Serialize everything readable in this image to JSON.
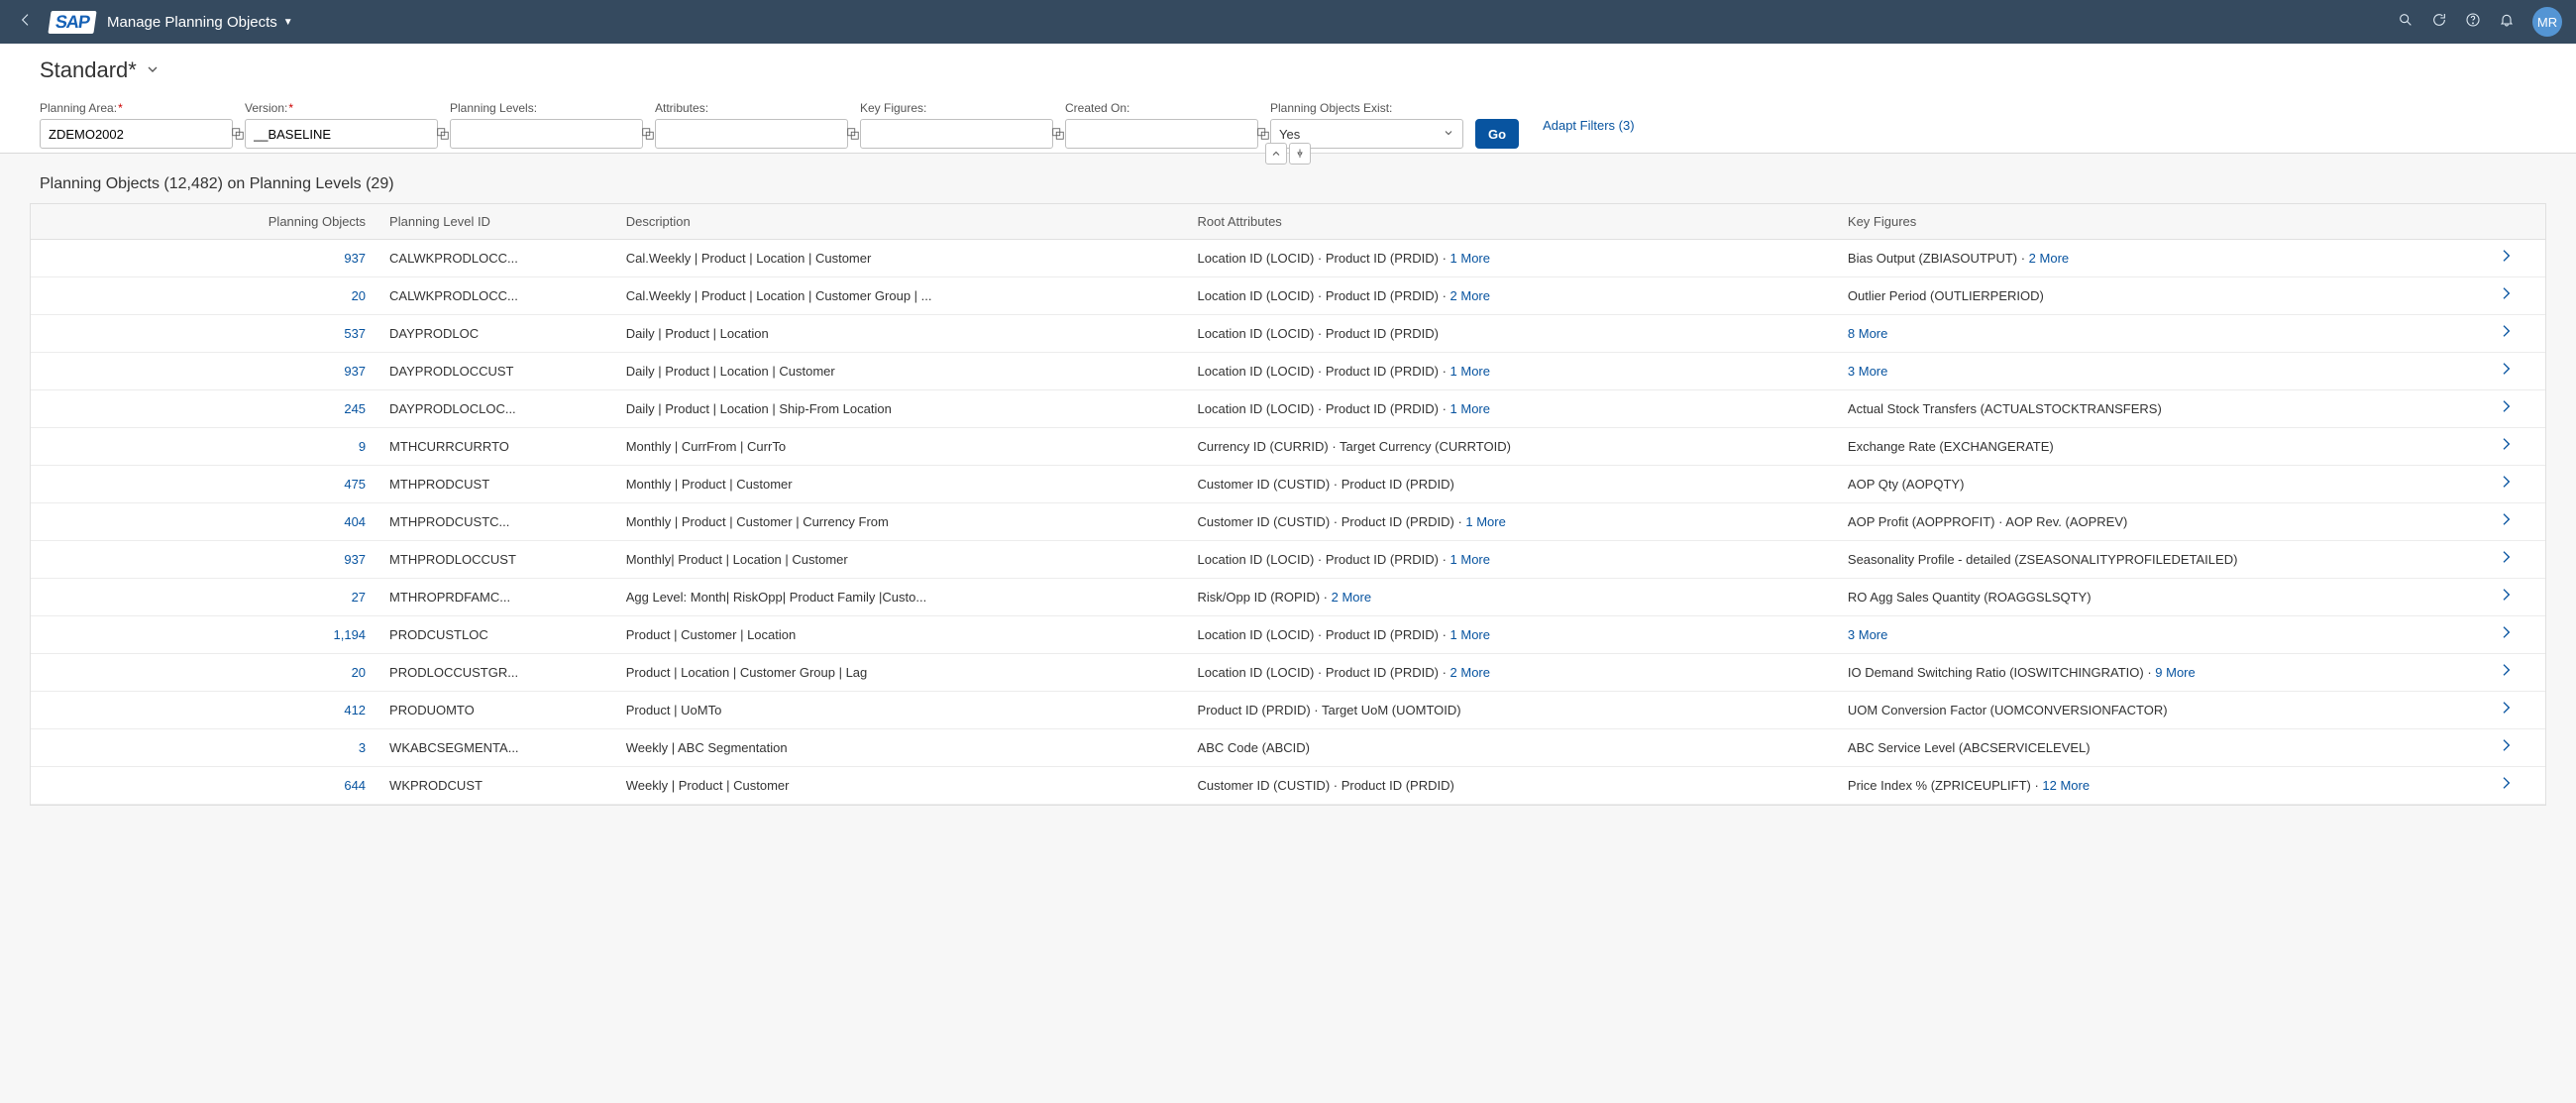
{
  "shell": {
    "app_title": "Manage Planning Objects",
    "avatar_initials": "MR"
  },
  "variant": {
    "title": "Standard*"
  },
  "filters": {
    "planning_area": {
      "label": "Planning Area:",
      "value": "ZDEMO2002"
    },
    "version": {
      "label": "Version:",
      "value": "__BASELINE"
    },
    "planning_levels": {
      "label": "Planning Levels:",
      "value": ""
    },
    "attributes": {
      "label": "Attributes:",
      "value": ""
    },
    "key_figures": {
      "label": "Key Figures:",
      "value": ""
    },
    "created_on": {
      "label": "Created On:",
      "value": ""
    },
    "exist": {
      "label": "Planning Objects Exist:",
      "value": "Yes"
    },
    "go_label": "Go",
    "adapt_label": "Adapt Filters (3)"
  },
  "table": {
    "title": "Planning Objects (12,482) on Planning Levels (29)",
    "columns": {
      "objects": "Planning Objects",
      "level": "Planning Level ID",
      "desc": "Description",
      "root": "Root Attributes",
      "kf": "Key Figures"
    },
    "rows": [
      {
        "count": "937",
        "level": "CALWKPRODLOCC...",
        "desc": "Cal.Weekly | Product | Location | Customer",
        "root": "Location ID (LOCID) · Product ID (PRDID)",
        "root_more": "1 More",
        "kf": "Bias Output (ZBIASOUTPUT)",
        "kf_more": "2 More"
      },
      {
        "count": "20",
        "level": "CALWKPRODLOCC...",
        "desc": "Cal.Weekly | Product | Location | Customer Group | ...",
        "root": "Location ID (LOCID) · Product ID (PRDID)",
        "root_more": "2 More",
        "kf": "Outlier Period (OUTLIERPERIOD)",
        "kf_more": ""
      },
      {
        "count": "537",
        "level": "DAYPRODLOC",
        "desc": "Daily | Product | Location",
        "root": "Location ID (LOCID) · Product ID (PRDID)",
        "root_more": "",
        "kf": "",
        "kf_more": "8 More"
      },
      {
        "count": "937",
        "level": "DAYPRODLOCCUST",
        "desc": "Daily | Product | Location | Customer",
        "root": "Location ID (LOCID) · Product ID (PRDID)",
        "root_more": "1 More",
        "kf": "",
        "kf_more": "3 More"
      },
      {
        "count": "245",
        "level": "DAYPRODLOCLOC...",
        "desc": "Daily | Product | Location | Ship-From Location",
        "root": "Location ID (LOCID) · Product ID (PRDID)",
        "root_more": "1 More",
        "kf": "Actual Stock Transfers (ACTUALSTOCKTRANSFERS)",
        "kf_more": ""
      },
      {
        "count": "9",
        "level": "MTHCURRCURRTO",
        "desc": "Monthly | CurrFrom | CurrTo",
        "root": "Currency ID (CURRID) · Target Currency (CURRTOID)",
        "root_more": "",
        "kf": "Exchange Rate (EXCHANGERATE)",
        "kf_more": ""
      },
      {
        "count": "475",
        "level": "MTHPRODCUST",
        "desc": "Monthly | Product | Customer",
        "root": "Customer ID (CUSTID) · Product ID (PRDID)",
        "root_more": "",
        "kf": "AOP Qty (AOPQTY)",
        "kf_more": ""
      },
      {
        "count": "404",
        "level": "MTHPRODCUSTC...",
        "desc": "Monthly | Product | Customer | Currency From",
        "root": "Customer ID (CUSTID) · Product ID (PRDID)",
        "root_more": "1 More",
        "kf": "AOP Profit (AOPPROFIT) · AOP Rev. (AOPREV)",
        "kf_more": ""
      },
      {
        "count": "937",
        "level": "MTHPRODLOCCUST",
        "desc": "Monthly| Product | Location | Customer",
        "root": "Location ID (LOCID) · Product ID (PRDID)",
        "root_more": "1 More",
        "kf": "Seasonality Profile - detailed (ZSEASONALITYPROFILEDETAILED)",
        "kf_more": ""
      },
      {
        "count": "27",
        "level": "MTHROPRDFAMC...",
        "desc": "Agg Level: Month| RiskOpp| Product Family |Custo...",
        "root": "Risk/Opp ID (ROPID)",
        "root_more": "2 More",
        "kf": "RO Agg Sales Quantity (ROAGGSLSQTY)",
        "kf_more": ""
      },
      {
        "count": "1,194",
        "level": "PRODCUSTLOC",
        "desc": "Product | Customer | Location",
        "root": "Location ID (LOCID) · Product ID (PRDID)",
        "root_more": "1 More",
        "kf": "",
        "kf_more": "3 More"
      },
      {
        "count": "20",
        "level": "PRODLOCCUSTGR...",
        "desc": "Product | Location | Customer Group | Lag",
        "root": "Location ID (LOCID) · Product ID (PRDID)",
        "root_more": "2 More",
        "kf": "IO Demand Switching Ratio (IOSWITCHINGRATIO)",
        "kf_more": "9 More"
      },
      {
        "count": "412",
        "level": "PRODUOMTO",
        "desc": "Product | UoMTo",
        "root": "Product ID (PRDID) · Target UoM (UOMTOID)",
        "root_more": "",
        "kf": "UOM Conversion Factor (UOMCONVERSIONFACTOR)",
        "kf_more": ""
      },
      {
        "count": "3",
        "level": "WKABCSEGMENTA...",
        "desc": "Weekly | ABC Segmentation",
        "root": "ABC Code (ABCID)",
        "root_more": "",
        "kf": "ABC Service Level (ABCSERVICELEVEL)",
        "kf_more": ""
      },
      {
        "count": "644",
        "level": "WKPRODCUST",
        "desc": "Weekly | Product | Customer",
        "root": "Customer ID (CUSTID) · Product ID (PRDID)",
        "root_more": "",
        "kf": "Price Index % (ZPRICEUPLIFT)",
        "kf_more": "12 More"
      }
    ]
  }
}
